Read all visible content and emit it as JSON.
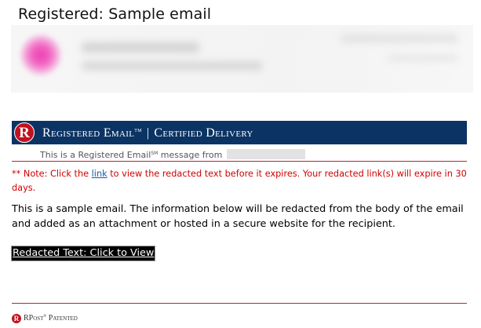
{
  "email": {
    "subject": "Registered: Sample email"
  },
  "banner": {
    "title_part1": "Registered Email",
    "trademark": "TM",
    "separator": "|",
    "title_part2": "Certified Delivery",
    "logo_letter": "R"
  },
  "registered_notice": {
    "text_prefix": "This is a Registered Email",
    "trademark": "SM",
    "text_suffix": " message from"
  },
  "note": {
    "prefix": "** Note: Click the ",
    "link_text": "link",
    "suffix": " to view the redacted text before it expires. Your redacted link(s) will expire in 30 days."
  },
  "body": {
    "text": "This is a sample email. The information below will be redacted from the body of the email and added as an attachment or hosted in a secure website for the recipient."
  },
  "redacted_link": {
    "label": "Redacted Text: Click to View"
  },
  "footer": {
    "logo_letter": "R",
    "brand": "RPost",
    "trademark": "®",
    "patented": " Patented"
  },
  "colors": {
    "banner_bg": "#0b3363",
    "logo_red": "#c1121f",
    "note_red": "#d00000",
    "link_blue": "#1a5aa6",
    "divider": "#b02a2a"
  }
}
